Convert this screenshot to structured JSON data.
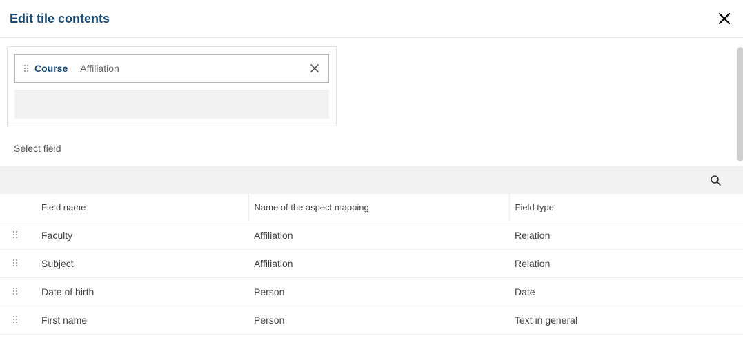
{
  "dialog": {
    "title": "Edit tile contents"
  },
  "tile": {
    "chip": {
      "label": "Course",
      "sublabel": "Affiliation"
    }
  },
  "section": {
    "select_field": "Select field"
  },
  "table": {
    "headers": {
      "field_name": "Field name",
      "aspect": "Name of the aspect mapping",
      "field_type": "Field type"
    },
    "rows": [
      {
        "name": "Faculty",
        "aspect": "Affiliation",
        "type": "Relation"
      },
      {
        "name": "Subject",
        "aspect": "Affiliation",
        "type": "Relation"
      },
      {
        "name": "Date of birth",
        "aspect": "Person",
        "type": "Date"
      },
      {
        "name": "First name",
        "aspect": "Person",
        "type": "Text in general"
      }
    ]
  }
}
